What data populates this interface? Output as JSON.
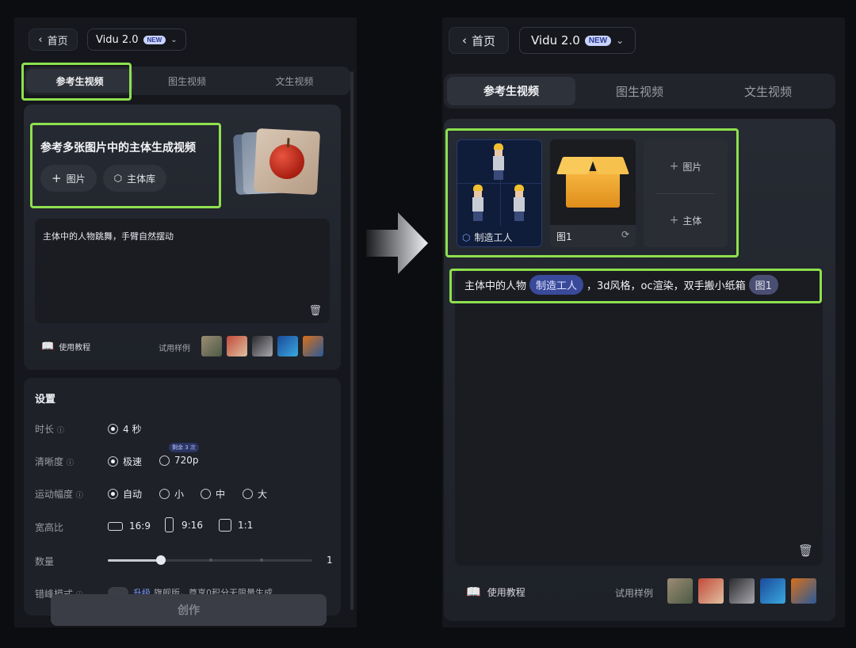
{
  "left": {
    "home_label": "首页",
    "model_name": "Vidu 2.0",
    "model_badge": "NEW",
    "tabs": [
      "参考生视频",
      "图生视频",
      "文生视频"
    ],
    "hero": {
      "title": "参考多张图片中的主体生成视频",
      "image_button": "图片",
      "subject_button": "主体库"
    },
    "prompt_text": "主体中的人物跳舞，手臂自然摆动",
    "tutorial_label": "使用教程",
    "examples_label": "试用样例",
    "settings": {
      "title": "设置",
      "duration_label": "时长",
      "duration_options": [
        "4 秒"
      ],
      "clarity_label": "清晰度",
      "clarity_options": [
        "极速",
        "720p"
      ],
      "clarity_badge": "剩余 3 次",
      "motion_label": "运动幅度",
      "motion_options": [
        "自动",
        "小",
        "中",
        "大"
      ],
      "ratio_label": "宽高比",
      "ratio_options": [
        "16:9",
        "9:16",
        "1:1"
      ],
      "count_label": "数量",
      "count_value": "1",
      "count_slider_value_fraction": 0.1,
      "offpeak_label": "错峰模式",
      "offpeak_upgrade": "升级",
      "offpeak_text": "旗舰版，尊享0积分无限量生成"
    },
    "create_label": "创作"
  },
  "right": {
    "home_label": "首页",
    "model_name": "Vidu 2.0",
    "model_badge": "NEW",
    "tabs": [
      "参考生视频",
      "图生视频",
      "文生视频"
    ],
    "ref1_label": "制造工人",
    "ref2_label": "图1",
    "add_image": "图片",
    "add_subject": "主体",
    "prompt": {
      "part1": "主体中的人物",
      "chip1": "制造工人",
      "part2": "，3d风格，oc渲染，双手搬小纸箱",
      "chip2": "图1"
    },
    "tutorial_label": "使用教程",
    "examples_label": "试用样例"
  },
  "colors": {
    "highlight": "#8ee04e",
    "chip_subject": "#3a4a9a",
    "chip_image": "#4a4e72"
  }
}
